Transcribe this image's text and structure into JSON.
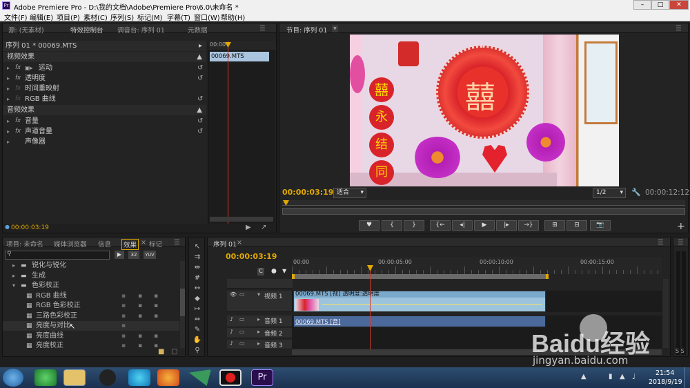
{
  "window": {
    "title": "Adobe Premiere Pro - D:\\我的文档\\Adobe\\Premiere Pro\\6.0\\未命名 *",
    "app_icon": "Pr"
  },
  "menu": [
    "文件(F)",
    "编辑(E)",
    "项目(P)",
    "素材(C)",
    "序列(S)",
    "标记(M)",
    "字幕(T)",
    "窗口(W)",
    "帮助(H)"
  ],
  "source_panel": {
    "tabs": [
      "源: (无素材)",
      "特效控制台",
      "调音台: 序列 01",
      "元数据"
    ],
    "sequence_label": "序列 01 * 00069.MTS",
    "ruler_time": "00:00",
    "clip_name": "00069.MTS",
    "video_header": "视频效果",
    "video_effects": [
      "运动",
      "透明度",
      "时间重映射",
      "RGB 曲线"
    ],
    "audio_header": "音频效果",
    "audio_effects": [
      "音量",
      "声道音量",
      "声像器"
    ],
    "fx_tag": "fx",
    "current_time": "00:00:03:19"
  },
  "program_panel": {
    "tab": "节目: 序列 01",
    "current_time": "00:00:03:19",
    "fit": "适合",
    "resolution": "1/2",
    "duration": "00:00:12:12",
    "image_texts": [
      "囍",
      "永",
      "结",
      "同"
    ]
  },
  "project_panel": {
    "tabs": [
      "项目: 未命名",
      "媒体浏览器",
      "信息",
      "效果",
      "标记"
    ],
    "badges": [
      "32",
      "YUV"
    ],
    "tree": [
      {
        "label": "锐化与锐化",
        "level": 1,
        "type": "folder"
      },
      {
        "label": "生成",
        "level": 1,
        "type": "folder"
      },
      {
        "label": "色彩校正",
        "level": 1,
        "type": "folder-open"
      },
      {
        "label": "RGB 曲线",
        "level": 2,
        "type": "effect"
      },
      {
        "label": "RGB 色彩校正",
        "level": 2,
        "type": "effect"
      },
      {
        "label": "三路色彩校正",
        "level": 2,
        "type": "effect"
      },
      {
        "label": "亮度与对比",
        "level": 2,
        "type": "effect"
      },
      {
        "label": "亮度曲线",
        "level": 2,
        "type": "effect"
      },
      {
        "label": "亮度校正",
        "level": 2,
        "type": "effect"
      }
    ]
  },
  "timeline": {
    "tab": "序列 01",
    "current_time": "00:00:03:19",
    "ruler": [
      "00:00",
      "00:00:05:00",
      "00:00:10:00",
      "00:00:15:00"
    ],
    "tracks": [
      {
        "name": "视频 1",
        "kind": "video"
      },
      {
        "name": "音频 1",
        "kind": "audio"
      },
      {
        "name": "音频 2",
        "kind": "audio"
      },
      {
        "name": "音频 3",
        "kind": "audio"
      }
    ],
    "video_clip": "00069.MTS [视] 透明度:透明度",
    "audio_clip": "00069.MTS [音]"
  },
  "taskbar": {
    "time": "21:54",
    "date": "2018/9/19"
  },
  "watermark": {
    "brand": "Baidu经验",
    "url": "jingyan.baidu.com"
  },
  "colors": {
    "accent": "#e0a800",
    "playhead": "#d93a2b",
    "video_clip": "#9cc4dc",
    "audio_clip": "#4b6a9b",
    "taskbar": "#1f3a5c"
  }
}
